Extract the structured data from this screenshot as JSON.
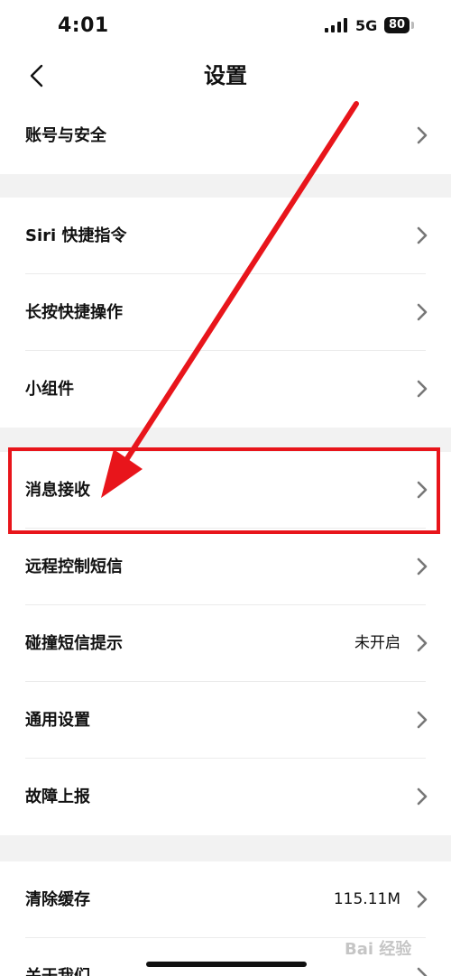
{
  "status_bar": {
    "time": "4:01",
    "network": "5G",
    "battery": "80",
    "icons": [
      "signal-icon",
      "battery-icon"
    ]
  },
  "nav": {
    "title": "设置",
    "back_icon": "chevron-left-icon"
  },
  "groups": [
    {
      "items": [
        {
          "label": "账号与安全",
          "value": ""
        }
      ]
    },
    {
      "items": [
        {
          "label": "Siri 快捷指令",
          "value": ""
        },
        {
          "label": "长按快捷操作",
          "value": ""
        },
        {
          "label": "小组件",
          "value": ""
        }
      ]
    },
    {
      "items": [
        {
          "label": "消息接收",
          "value": ""
        },
        {
          "label": "远程控制短信",
          "value": ""
        },
        {
          "label": "碰撞短信提示",
          "value": "未开启"
        },
        {
          "label": "通用设置",
          "value": ""
        },
        {
          "label": "故障上报",
          "value": ""
        }
      ]
    },
    {
      "items": [
        {
          "label": "清除缓存",
          "value": "115.11M"
        },
        {
          "label": "关于我们",
          "value": ""
        }
      ]
    }
  ],
  "annotation": {
    "color": "#e8151b",
    "highlighted_item": "消息接收"
  },
  "watermark": "Bai 经验"
}
